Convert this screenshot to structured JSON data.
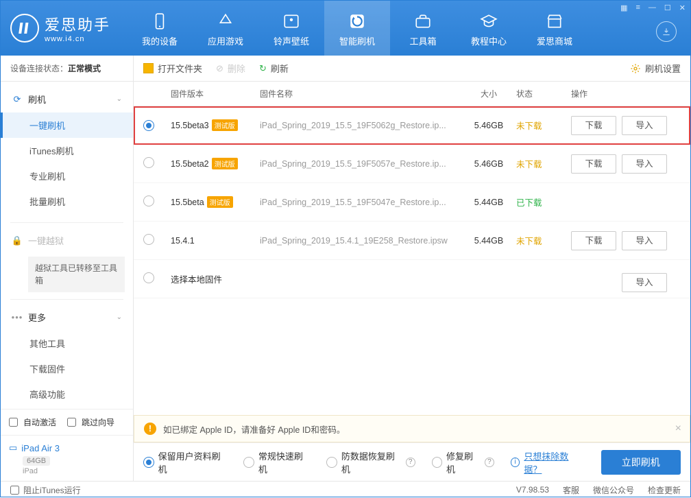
{
  "brand": {
    "name": "爱思助手",
    "url": "www.i4.cn"
  },
  "nav": {
    "items": [
      {
        "label": "我的设备"
      },
      {
        "label": "应用游戏"
      },
      {
        "label": "铃声壁纸"
      },
      {
        "label": "智能刷机"
      },
      {
        "label": "工具箱"
      },
      {
        "label": "教程中心"
      },
      {
        "label": "爱思商城"
      }
    ]
  },
  "connection": {
    "prefix": "设备连接状态：",
    "mode": "正常模式"
  },
  "sidebar": {
    "flash": {
      "title": "刷机",
      "items": [
        "一键刷机",
        "iTunes刷机",
        "专业刷机",
        "批量刷机"
      ]
    },
    "jailbreak": {
      "title": "一键越狱",
      "note": "越狱工具已转移至工具箱"
    },
    "more": {
      "title": "更多",
      "items": [
        "其他工具",
        "下载固件",
        "高级功能"
      ]
    },
    "auto": {
      "activate": "自动激活",
      "skip": "跳过向导"
    },
    "device": {
      "name": "iPad Air 3",
      "storage": "64GB",
      "type": "iPad"
    }
  },
  "toolbar": {
    "open": "打开文件夹",
    "delete": "删除",
    "refresh": "刷新",
    "settings": "刷机设置"
  },
  "columns": {
    "version": "固件版本",
    "name": "固件名称",
    "size": "大小",
    "status": "状态",
    "ops": "操作"
  },
  "rows": [
    {
      "version": "15.5beta3",
      "beta": "测试版",
      "name": "iPad_Spring_2019_15.5_19F5062g_Restore.ip...",
      "size": "5.46GB",
      "status": "未下载",
      "statusClass": "not",
      "selected": true,
      "showDownload": true
    },
    {
      "version": "15.5beta2",
      "beta": "测试版",
      "name": "iPad_Spring_2019_15.5_19F5057e_Restore.ip...",
      "size": "5.46GB",
      "status": "未下载",
      "statusClass": "not",
      "selected": false,
      "showDownload": true
    },
    {
      "version": "15.5beta",
      "beta": "测试版",
      "name": "iPad_Spring_2019_15.5_19F5047e_Restore.ip...",
      "size": "5.44GB",
      "status": "已下载",
      "statusClass": "done",
      "selected": false,
      "showDownload": false
    },
    {
      "version": "15.4.1",
      "beta": "",
      "name": "iPad_Spring_2019_15.4.1_19E258_Restore.ipsw",
      "size": "5.44GB",
      "status": "未下载",
      "statusClass": "not",
      "selected": false,
      "showDownload": true
    }
  ],
  "local_row": {
    "label": "选择本地固件",
    "import": "导入"
  },
  "ops": {
    "download": "下载",
    "import": "导入"
  },
  "banner": {
    "text": "如已绑定 Apple ID，请准备好 Apple ID和密码。"
  },
  "options": {
    "keep": "保留用户资料刷机",
    "normal": "常规快速刷机",
    "antiloss": "防数据恢复刷机",
    "repair": "修复刷机",
    "erase_link": "只想抹除数据？",
    "go": "立即刷机"
  },
  "footer": {
    "block_itunes": "阻止iTunes运行",
    "version": "V7.98.53",
    "service": "客服",
    "wechat": "微信公众号",
    "update": "检查更新"
  }
}
